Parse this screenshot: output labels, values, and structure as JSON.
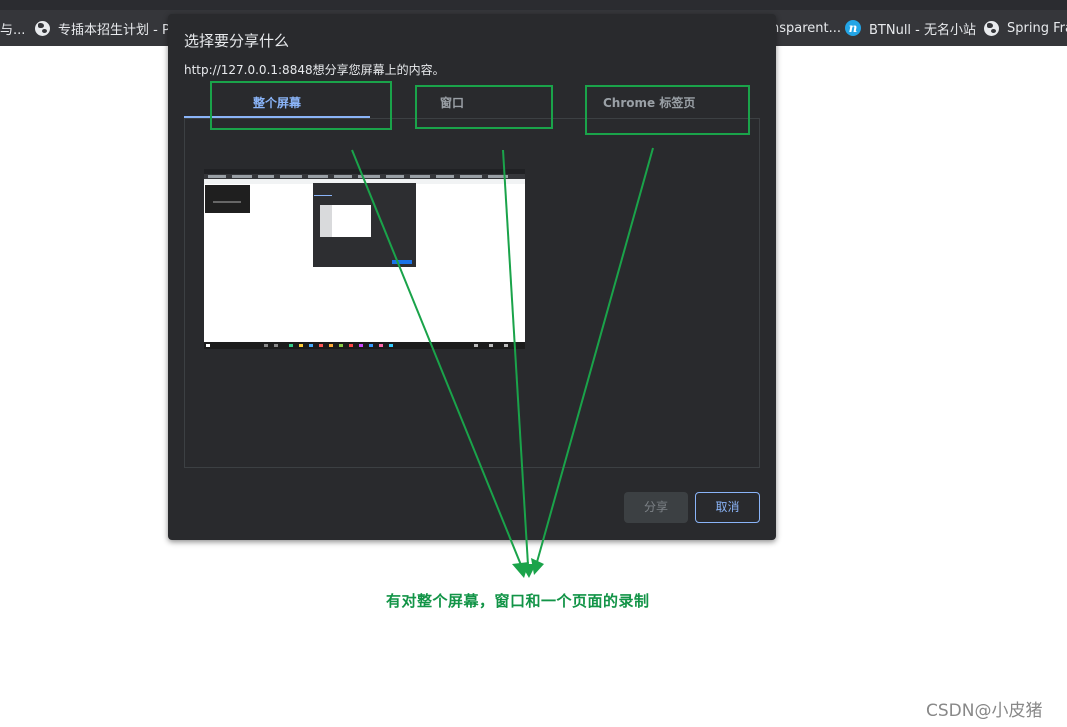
{
  "bookmarks": [
    {
      "label": "与...",
      "icon": "none"
    },
    {
      "label": "专插本招生计划 - P...",
      "icon": "globe-icon"
    },
    {
      "label": "nsparent...",
      "icon": "none"
    },
    {
      "label": "BTNull - 无名小站",
      "icon": "btnull-logo-icon"
    },
    {
      "label": "Spring Fra",
      "icon": "globe-icon"
    }
  ],
  "dialog": {
    "title": "选择要分享什么",
    "message": "http://127.0.0.1:8848想分享您屏幕上的内容。",
    "tabs": [
      {
        "label": "整个屏幕",
        "selected": true
      },
      {
        "label": "窗口",
        "selected": false
      },
      {
        "label": "Chrome 标签页",
        "selected": false
      }
    ],
    "share_button": "分享",
    "cancel_button": "取消"
  },
  "annotation": {
    "caption": "有对整个屏幕，窗口和一个页面的录制",
    "color": "#1aa34a"
  },
  "watermark": "CSDN@小皮猪",
  "colors": {
    "dialog_bg": "#292a2d",
    "accent": "#8ab4f8",
    "bookmark_bar": "#35363a"
  }
}
